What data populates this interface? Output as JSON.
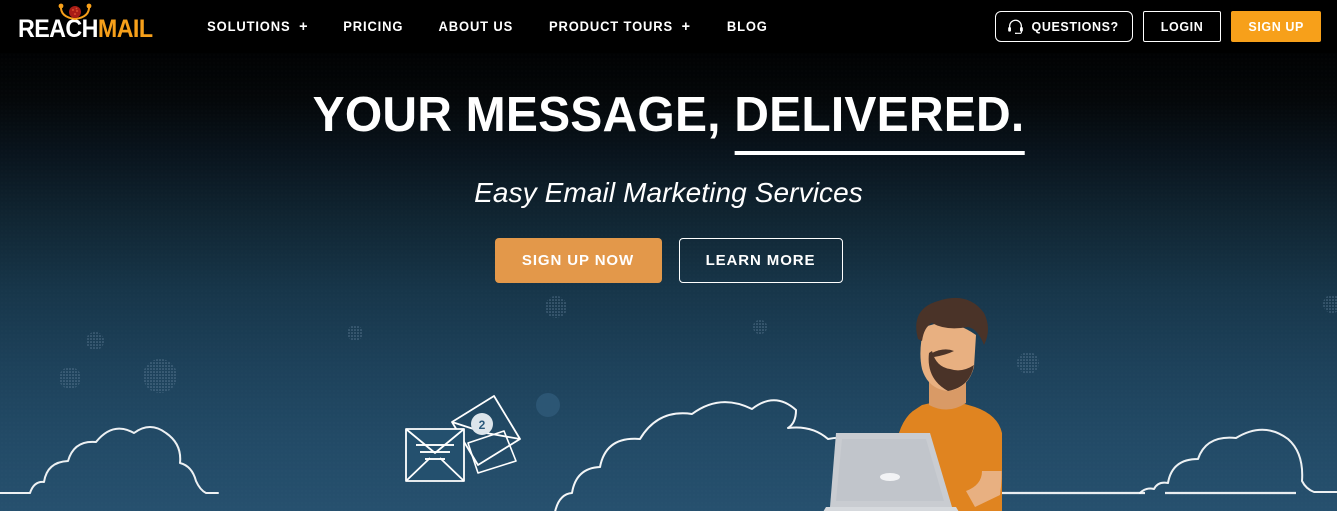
{
  "brand": {
    "name_part1": "REACH",
    "name_part2": "MAIL",
    "accent_color": "#f7a01a",
    "figure_icon": "person-arms-up-icon"
  },
  "header": {
    "background_color": "#000000",
    "nav": [
      {
        "label": "SOLUTIONS",
        "has_dropdown": true,
        "dropdown_glyph": "+"
      },
      {
        "label": "PRICING",
        "has_dropdown": false,
        "dropdown_glyph": ""
      },
      {
        "label": "ABOUT US",
        "has_dropdown": false,
        "dropdown_glyph": ""
      },
      {
        "label": "PRODUCT TOURS",
        "has_dropdown": true,
        "dropdown_glyph": "+"
      },
      {
        "label": "BLOG",
        "has_dropdown": false,
        "dropdown_glyph": ""
      }
    ],
    "actions": {
      "questions_label": "QUESTIONS?",
      "questions_icon": "headset-icon",
      "login_label": "LOGIN",
      "signup_label": "SIGN UP",
      "signup_color": "#f7a01a"
    }
  },
  "hero": {
    "title_line1": "YOUR MESSAGE, ",
    "title_emphasis": "DELIVERED.",
    "subtitle": "Easy Email Marketing Services",
    "primary_cta": "SIGN UP NOW",
    "primary_cta_color": "#e3984a",
    "secondary_cta": "LEARN MORE",
    "gradient_top": "#010203",
    "gradient_bottom": "#26506e"
  },
  "illustration": {
    "description": "night sky line-art scene",
    "envelope_badge_count": "2",
    "items": [
      "cloud-outline-left",
      "cloud-outline-center",
      "cloud-outline-right",
      "envelope-icon",
      "envelope-badge",
      "laptop-icon",
      "person-with-laptop",
      "dotted-circle",
      "horizon-line"
    ],
    "person": {
      "shirt_color": "#e08420",
      "skin_color": "#e8b081",
      "hair_color": "#4a3328",
      "laptop_color": "#c9ccd1"
    }
  }
}
